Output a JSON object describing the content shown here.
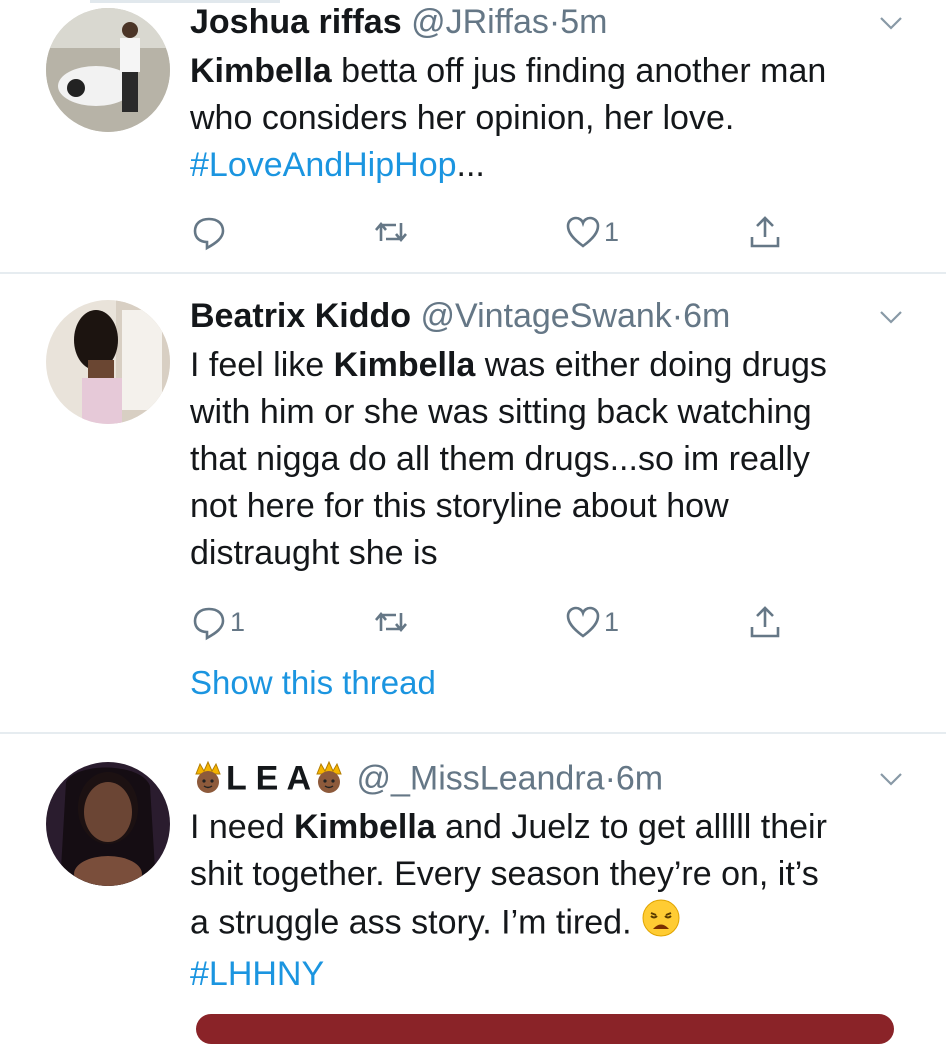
{
  "tweets": [
    {
      "name": "Joshua riffas",
      "handle": "@JRiffas",
      "sep": "·",
      "time": "5m",
      "text_bold": "Kimbella",
      "text_line1_rest": " betta off jus finding another man",
      "text_line2": "who considers her opinion, her love.",
      "hashtag": "#LoveAndHipHop",
      "ellipsis": "...",
      "reply_count": "",
      "retweet_count": "",
      "like_count": "1"
    },
    {
      "name": "Beatrix Kiddo",
      "handle": "@VintageSwank",
      "sep": "·",
      "time": "6m",
      "text_pre": "I feel like ",
      "text_bold": "Kimbella",
      "text_line1_rest": " was either doing drugs",
      "text_line2": "with him or she was sitting back watching",
      "text_line3": "that nigga do all them drugs...so im really",
      "text_line4": "not here for this storyline about how",
      "text_line5": "distraught she is",
      "reply_count": "1",
      "retweet_count": "",
      "like_count": "1",
      "show_thread": "Show this thread"
    },
    {
      "name": "L E A",
      "name_emoji": "👸🏾",
      "handle": "@_MissLeandra",
      "sep": "·",
      "time": "6m",
      "text_pre": "I need ",
      "text_bold": "Kimbella",
      "text_line1_rest": " and Juelz to get alllll their",
      "text_line2": "shit together. Every season they’re on, it’s",
      "text_line3": "a struggle ass story. I’m tired.",
      "hashtag": "#LHHNY"
    }
  ],
  "icons": {
    "reply": "reply-icon",
    "retweet": "retweet-icon",
    "like": "heart-icon",
    "share": "share-icon",
    "caret": "chevron-down-icon",
    "emoji_tired": "weary-face-icon",
    "emoji_crown": "princess-icon"
  },
  "colors": {
    "link": "#1b95e0",
    "muted": "#657786",
    "text": "#14171a",
    "divider": "#e6ecf0"
  }
}
